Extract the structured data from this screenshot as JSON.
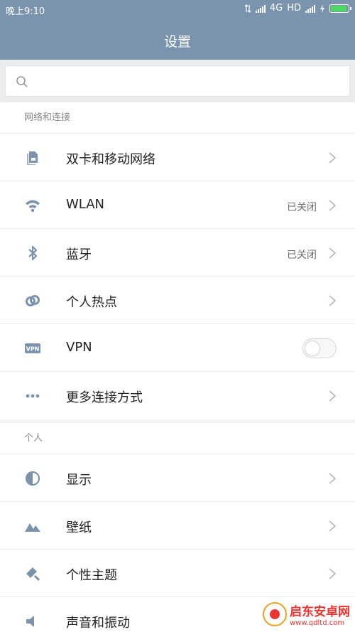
{
  "status_bar": {
    "time": "晚上9:10",
    "network": "4G",
    "hd": "HD"
  },
  "header": {
    "title": "设置"
  },
  "search": {
    "placeholder": "",
    "value": ""
  },
  "sections": [
    {
      "title": "网络和连接",
      "items": [
        {
          "label": "双卡和移动网络",
          "value": "",
          "icon": "sim-card-icon"
        },
        {
          "label": "WLAN",
          "value": "已关闭",
          "icon": "wifi-icon"
        },
        {
          "label": "蓝牙",
          "value": "已关闭",
          "icon": "bluetooth-icon"
        },
        {
          "label": "个人热点",
          "value": "",
          "icon": "hotspot-icon"
        },
        {
          "label": "VPN",
          "value": "",
          "icon": "vpn-icon",
          "toggle": false
        },
        {
          "label": "更多连接方式",
          "value": "",
          "icon": "more-dots-icon"
        }
      ]
    },
    {
      "title": "个人",
      "items": [
        {
          "label": "显示",
          "value": "",
          "icon": "display-icon"
        },
        {
          "label": "壁纸",
          "value": "",
          "icon": "wallpaper-icon"
        },
        {
          "label": "个性主题",
          "value": "",
          "icon": "theme-icon"
        },
        {
          "label": "声音和振动",
          "value": "",
          "icon": "sound-icon"
        }
      ]
    }
  ],
  "watermark": {
    "main": "启东安卓网",
    "sub": "www.qdltd.com"
  },
  "colors": {
    "header_bg": "#7a94ad",
    "icon_color": "#7b93ad",
    "battery_green": "#4cd964"
  }
}
